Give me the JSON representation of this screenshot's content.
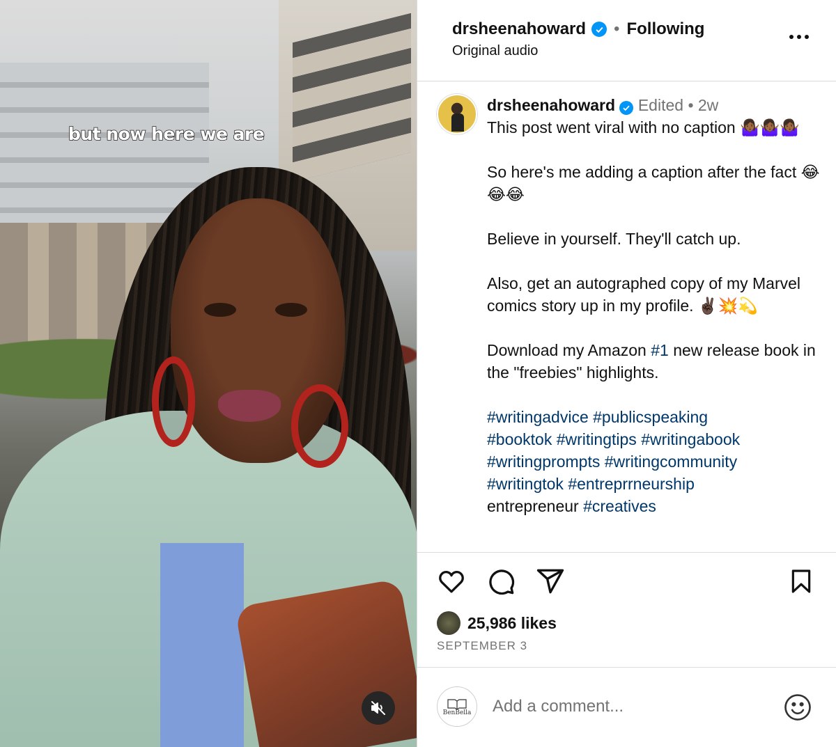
{
  "video": {
    "overlay_text": "but now here we are",
    "mute_icon": "speaker-muted-icon"
  },
  "header": {
    "username": "drsheenahoward",
    "separator": "•",
    "follow_status": "Following",
    "audio": "Original audio",
    "more_icon": "more-options-icon"
  },
  "post": {
    "username": "drsheenahoward",
    "edited": "Edited",
    "separator": "•",
    "time_ago": "2w",
    "paragraphs": [
      "This post went viral with no caption 🤷🏾‍♀️🤷🏾‍♀️🤷🏾‍♀️",
      "So here's me adding a caption after the fact 😂😂😂",
      "Believe in yourself. They'll catch up.",
      "Also, get an autographed copy of my Marvel comics story up in my profile. ✌🏿💥💫"
    ],
    "download_pre": "Download my Amazon ",
    "download_tag": "#1",
    "download_post": " new release book in the \"freebies\" highlights.",
    "hashtags_line1": [
      "#writingadvice",
      "#publicspeaking"
    ],
    "hashtags_line2": [
      "#booktok",
      "#writingtips",
      "#writingabook"
    ],
    "hashtags_line3": [
      "#writingprompts",
      "#writingcommunity"
    ],
    "hashtags_line4": [
      "#writingtok",
      "#entreprrneurship"
    ],
    "hashtags_line5_text": "entrepreneur",
    "hashtags_line5_tag": "#creatives"
  },
  "actions": {
    "like_icon": "heart-icon",
    "comment_icon": "comment-icon",
    "share_icon": "send-icon",
    "save_icon": "bookmark-icon"
  },
  "likes": {
    "count_text": "25,986 likes",
    "date": "SEPTEMBER 3"
  },
  "comment_box": {
    "avatar_text": "BenBella",
    "placeholder": "Add a comment...",
    "emoji_icon": "smiley-icon"
  },
  "colors": {
    "verified": "#0095f6",
    "hashtag": "#00376b",
    "muted_text": "#737373",
    "border": "#dbdbdb"
  }
}
